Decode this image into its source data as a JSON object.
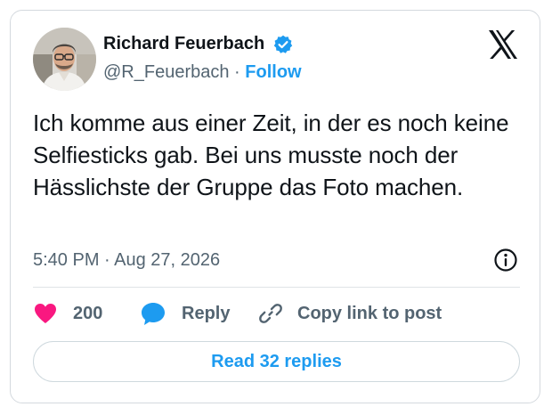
{
  "author": {
    "name": "Richard Feuerbach",
    "handle": "@R_Feuerbach",
    "separator": "·",
    "follow_label": "Follow",
    "avatar_icon": "profile-photo",
    "verified_icon": "verified-badge-icon"
  },
  "tweet": {
    "text": "Ich komme aus einer Zeit, in der es noch keine Selfiesticks gab. Bei uns musste noch der Hässlichste der Gruppe das Foto machen.",
    "timestamp": "5:40 PM · Aug 27, 2026"
  },
  "actions": {
    "like_count": "200",
    "reply_label": "Reply",
    "copy_link_label": "Copy link to post"
  },
  "read_replies_label": "Read 32 replies",
  "colors": {
    "accent": "#1d9bf0",
    "like": "#f91880",
    "text": "#0f1419",
    "muted": "#536471"
  }
}
